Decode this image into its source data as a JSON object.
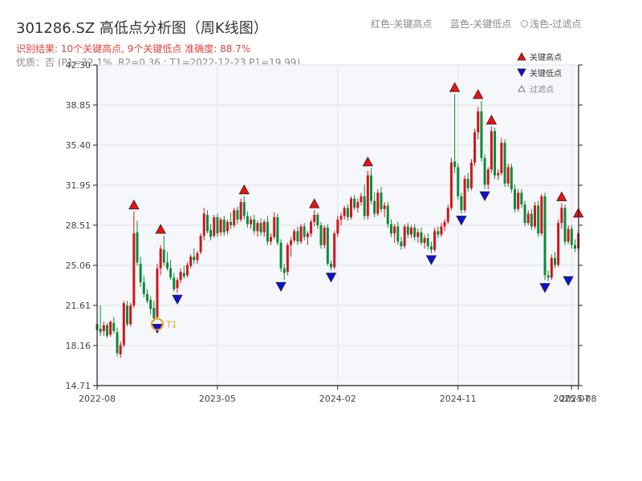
{
  "header": {
    "title": "301286.SZ 高低点分析图（周K线图）",
    "result": "识别结果: 10个关键高点, 9个关键低点   准确度: 88.7%",
    "quality": "优质：否 (P1=32.1%, R2=0.36 ; T1=2022-12-23 P1=19.99)"
  },
  "hints": {
    "red": "红色-关键高点",
    "blue": "蓝色-关键低点",
    "light": "浅色-过滤点"
  },
  "legend": {
    "high": "关键高点",
    "low": "关键低点",
    "filtered": "过滤点"
  },
  "colors": {
    "up": "#d0161c",
    "down": "#0a8c3a",
    "high_marker": "#ee1111",
    "low_marker": "#1010dd",
    "t1_marker": "#f0a020",
    "axis": "#222222",
    "grid": "#e2e2e2",
    "plot_bg": "#f5f7fa"
  },
  "chart_data": {
    "type": "candlestick",
    "x_range": [
      0,
      1
    ],
    "ylim": [
      14.71,
      42.3
    ],
    "yticks": [
      "14.71",
      "18.16",
      "21.61",
      "25.06",
      "28.51",
      "31.95",
      "35.40",
      "38.85",
      "42.30"
    ],
    "xticks": [
      {
        "x": 0.0,
        "label": "2022-08"
      },
      {
        "x": 0.2498,
        "label": "2023-05"
      },
      {
        "x": 0.4996,
        "label": "2024-02"
      },
      {
        "x": 0.7495,
        "label": "2024-11"
      },
      {
        "x": 0.9854,
        "label": "2025-07"
      },
      {
        "x": 0.9993,
        "label": "2025-08"
      }
    ],
    "candles": [
      [
        0.0,
        20.0,
        20.5,
        19.3,
        19.5
      ],
      [
        0.0069,
        19.6,
        21.6,
        19.0,
        19.3
      ],
      [
        0.0139,
        19.4,
        20.2,
        19.0,
        19.9
      ],
      [
        0.0208,
        19.9,
        20.1,
        18.8,
        19.0
      ],
      [
        0.0278,
        19.1,
        20.3,
        18.9,
        20.2
      ],
      [
        0.0347,
        20.1,
        20.6,
        19.2,
        19.4
      ],
      [
        0.0417,
        19.3,
        19.7,
        17.2,
        17.5
      ],
      [
        0.0486,
        17.4,
        18.5,
        17.1,
        18.2
      ],
      [
        0.0555,
        18.2,
        22.0,
        18.0,
        21.8
      ],
      [
        0.0625,
        21.6,
        22.0,
        19.8,
        20.0
      ],
      [
        0.0694,
        20.0,
        21.8,
        19.8,
        21.6
      ],
      [
        0.0764,
        21.6,
        29.7,
        21.4,
        27.8
      ],
      [
        0.0833,
        27.9,
        28.9,
        25.0,
        25.3
      ],
      [
        0.0902,
        25.2,
        25.8,
        23.2,
        23.6
      ],
      [
        0.0972,
        23.6,
        24.2,
        22.3,
        22.6
      ],
      [
        0.1041,
        22.6,
        23.0,
        21.8,
        22.0
      ],
      [
        0.1111,
        22.1,
        22.4,
        20.8,
        21.3
      ],
      [
        0.118,
        21.4,
        22.0,
        20.2,
        20.5
      ],
      [
        0.1249,
        20.6,
        25.2,
        20.4,
        24.8
      ],
      [
        0.1319,
        24.8,
        26.8,
        24.2,
        26.5
      ],
      [
        0.1388,
        26.4,
        27.6,
        25.0,
        25.3
      ],
      [
        0.1458,
        25.3,
        26.2,
        24.6,
        24.8
      ],
      [
        0.1527,
        24.8,
        25.5,
        23.8,
        24.0
      ],
      [
        0.1596,
        24.0,
        24.4,
        22.8,
        23.0
      ],
      [
        0.1666,
        23.1,
        24.0,
        22.7,
        23.8
      ],
      [
        0.1735,
        23.8,
        24.8,
        23.5,
        24.5
      ],
      [
        0.1805,
        24.4,
        25.0,
        23.9,
        24.1
      ],
      [
        0.1874,
        24.2,
        25.3,
        24.0,
        25.1
      ],
      [
        0.1944,
        25.0,
        26.0,
        24.8,
        25.8
      ],
      [
        0.2013,
        25.8,
        26.5,
        25.2,
        25.5
      ],
      [
        0.2082,
        25.5,
        26.3,
        25.2,
        26.1
      ],
      [
        0.2152,
        26.2,
        27.8,
        26.0,
        27.6
      ],
      [
        0.2221,
        27.6,
        30.0,
        27.2,
        29.5
      ],
      [
        0.2291,
        29.4,
        29.8,
        27.8,
        28.0
      ],
      [
        0.236,
        28.1,
        28.6,
        27.2,
        27.5
      ],
      [
        0.2429,
        27.6,
        29.4,
        27.4,
        29.2
      ],
      [
        0.2499,
        29.2,
        29.5,
        27.5,
        27.8
      ],
      [
        0.2568,
        27.9,
        29.2,
        27.6,
        29.0
      ],
      [
        0.2638,
        29.0,
        29.3,
        27.6,
        27.9
      ],
      [
        0.2707,
        28.0,
        29.0,
        27.7,
        28.8
      ],
      [
        0.2776,
        28.8,
        29.6,
        28.2,
        28.5
      ],
      [
        0.2846,
        28.5,
        30.0,
        28.3,
        29.8
      ],
      [
        0.2915,
        29.8,
        30.1,
        28.6,
        29.0
      ],
      [
        0.2985,
        29.0,
        30.8,
        28.8,
        30.5
      ],
      [
        0.3054,
        30.5,
        31.0,
        29.0,
        29.3
      ],
      [
        0.3123,
        29.3,
        29.7,
        28.3,
        28.6
      ],
      [
        0.3193,
        28.6,
        29.3,
        28.2,
        29.0
      ],
      [
        0.3262,
        29.0,
        29.4,
        27.7,
        28.0
      ],
      [
        0.3332,
        28.0,
        28.9,
        27.5,
        28.7
      ],
      [
        0.3401,
        28.7,
        29.1,
        27.6,
        27.9
      ],
      [
        0.347,
        27.9,
        29.0,
        27.5,
        28.8
      ],
      [
        0.354,
        28.8,
        29.3,
        26.8,
        27.1
      ],
      [
        0.3609,
        27.1,
        27.8,
        26.8,
        27.5
      ],
      [
        0.3679,
        27.5,
        29.6,
        27.3,
        29.2
      ],
      [
        0.3748,
        29.2,
        29.5,
        26.8,
        27.0
      ],
      [
        0.3818,
        27.0,
        27.3,
        24.5,
        24.8
      ],
      [
        0.3887,
        24.8,
        25.2,
        23.8,
        24.4
      ],
      [
        0.3956,
        24.5,
        27.0,
        24.2,
        26.8
      ],
      [
        0.4026,
        26.8,
        27.5,
        25.8,
        27.2
      ],
      [
        0.4095,
        27.2,
        28.2,
        27.0,
        28.0
      ],
      [
        0.4165,
        28.0,
        28.4,
        26.8,
        27.1
      ],
      [
        0.4234,
        27.1,
        28.6,
        26.9,
        28.4
      ],
      [
        0.4303,
        28.4,
        28.7,
        27.2,
        27.5
      ],
      [
        0.4373,
        27.5,
        28.0,
        26.8,
        27.8
      ],
      [
        0.4442,
        27.8,
        29.0,
        27.5,
        28.8
      ],
      [
        0.4512,
        28.8,
        29.8,
        28.4,
        29.4
      ],
      [
        0.4581,
        29.4,
        29.6,
        28.2,
        28.5
      ],
      [
        0.465,
        28.5,
        28.8,
        26.5,
        26.8
      ],
      [
        0.472,
        26.8,
        28.5,
        26.5,
        28.3
      ],
      [
        0.4789,
        28.3,
        28.6,
        25.0,
        25.2
      ],
      [
        0.4859,
        25.2,
        25.5,
        24.6,
        24.9
      ],
      [
        0.4928,
        24.9,
        28.0,
        24.7,
        27.8
      ],
      [
        0.4997,
        27.8,
        29.3,
        27.5,
        29.0
      ],
      [
        0.5067,
        29.0,
        29.6,
        28.5,
        29.3
      ],
      [
        0.5136,
        29.3,
        30.2,
        29.0,
        30.0
      ],
      [
        0.5206,
        30.0,
        30.3,
        28.9,
        29.2
      ],
      [
        0.5275,
        29.2,
        31.0,
        29.0,
        30.8
      ],
      [
        0.5344,
        30.8,
        31.1,
        29.8,
        30.0
      ],
      [
        0.5414,
        30.0,
        30.8,
        29.6,
        30.5
      ],
      [
        0.5483,
        30.5,
        31.3,
        30.2,
        31.0
      ],
      [
        0.5553,
        31.0,
        32.0,
        29.0,
        29.3
      ],
      [
        0.5622,
        29.3,
        33.2,
        29.0,
        32.8
      ],
      [
        0.5691,
        32.8,
        33.4,
        30.3,
        30.6
      ],
      [
        0.5761,
        30.6,
        31.3,
        29.2,
        29.5
      ],
      [
        0.583,
        29.5,
        31.6,
        29.3,
        31.3
      ],
      [
        0.59,
        31.3,
        31.8,
        29.6,
        29.9
      ],
      [
        0.5969,
        29.9,
        30.5,
        29.2,
        30.2
      ],
      [
        0.6038,
        30.2,
        30.5,
        28.3,
        28.6
      ],
      [
        0.6108,
        28.6,
        29.0,
        27.5,
        27.8
      ],
      [
        0.6177,
        27.8,
        28.6,
        27.0,
        28.4
      ],
      [
        0.6247,
        28.4,
        28.8,
        26.8,
        27.1
      ],
      [
        0.6316,
        27.1,
        27.5,
        26.4,
        26.7
      ],
      [
        0.6386,
        26.7,
        28.6,
        26.5,
        28.4
      ],
      [
        0.6455,
        28.4,
        28.7,
        27.4,
        27.7
      ],
      [
        0.6524,
        27.7,
        28.5,
        27.4,
        28.3
      ],
      [
        0.6594,
        28.3,
        28.6,
        27.2,
        27.5
      ],
      [
        0.6663,
        27.5,
        28.2,
        27.0,
        27.9
      ],
      [
        0.6733,
        27.9,
        28.3,
        26.8,
        27.0
      ],
      [
        0.6802,
        27.0,
        27.7,
        26.5,
        27.4
      ],
      [
        0.6871,
        27.4,
        27.8,
        26.4,
        26.7
      ],
      [
        0.6941,
        26.7,
        27.1,
        26.1,
        26.4
      ],
      [
        0.701,
        26.4,
        28.3,
        26.2,
        28.0
      ],
      [
        0.708,
        28.0,
        28.4,
        27.4,
        27.7
      ],
      [
        0.7149,
        27.7,
        28.7,
        27.5,
        28.4
      ],
      [
        0.7218,
        28.4,
        29.0,
        28.0,
        28.8
      ],
      [
        0.7288,
        28.8,
        30.3,
        28.6,
        30.0
      ],
      [
        0.7357,
        30.0,
        34.3,
        29.8,
        33.9
      ],
      [
        0.7427,
        34.0,
        39.8,
        33.0,
        33.5
      ],
      [
        0.7496,
        33.5,
        33.8,
        30.7,
        31.0
      ],
      [
        0.7565,
        31.0,
        31.3,
        29.5,
        29.8
      ],
      [
        0.7635,
        29.8,
        32.8,
        29.6,
        32.5
      ],
      [
        0.7704,
        32.5,
        33.0,
        31.4,
        31.7
      ],
      [
        0.7774,
        31.7,
        34.2,
        31.5,
        33.9
      ],
      [
        0.7843,
        33.9,
        36.8,
        33.6,
        36.5
      ],
      [
        0.7912,
        36.5,
        38.7,
        35.9,
        38.3
      ],
      [
        0.7982,
        38.3,
        39.2,
        34.0,
        34.3
      ],
      [
        0.8051,
        34.3,
        34.6,
        31.6,
        32.0
      ],
      [
        0.8121,
        32.0,
        33.5,
        31.6,
        33.3
      ],
      [
        0.819,
        33.3,
        37.0,
        33.0,
        36.6
      ],
      [
        0.8259,
        36.6,
        36.9,
        32.5,
        32.8
      ],
      [
        0.8329,
        32.8,
        33.3,
        32.4,
        33.0
      ],
      [
        0.8398,
        33.0,
        36.0,
        32.8,
        35.6
      ],
      [
        0.8468,
        35.6,
        35.9,
        31.8,
        32.1
      ],
      [
        0.8537,
        32.1,
        33.8,
        31.8,
        33.5
      ],
      [
        0.8606,
        33.5,
        33.8,
        31.3,
        31.6
      ],
      [
        0.8676,
        31.6,
        32.0,
        29.6,
        29.9
      ],
      [
        0.8745,
        29.9,
        31.6,
        29.7,
        31.3
      ],
      [
        0.8815,
        31.3,
        31.6,
        30.0,
        30.3
      ],
      [
        0.8884,
        30.3,
        30.6,
        28.4,
        28.7
      ],
      [
        0.8954,
        28.7,
        29.8,
        28.5,
        29.5
      ],
      [
        0.9023,
        29.5,
        29.9,
        28.1,
        28.4
      ],
      [
        0.9092,
        28.4,
        30.5,
        28.2,
        30.2
      ],
      [
        0.9162,
        30.2,
        30.6,
        27.5,
        27.8
      ],
      [
        0.9231,
        27.8,
        31.2,
        27.6,
        31.0
      ],
      [
        0.9301,
        31.0,
        31.3,
        23.8,
        24.2
      ],
      [
        0.937,
        24.2,
        24.6,
        23.7,
        24.0
      ],
      [
        0.9439,
        24.0,
        26.0,
        23.8,
        25.7
      ],
      [
        0.9509,
        25.7,
        26.2,
        24.8,
        25.1
      ],
      [
        0.9578,
        25.1,
        29.0,
        24.9,
        28.7
      ],
      [
        0.9648,
        28.7,
        30.4,
        28.2,
        30.0
      ],
      [
        0.9717,
        30.0,
        30.3,
        26.8,
        27.1
      ],
      [
        0.9786,
        27.1,
        28.5,
        26.9,
        28.2
      ],
      [
        0.9856,
        28.2,
        28.5,
        26.5,
        26.8
      ],
      [
        0.9925,
        26.8,
        27.3,
        26.2,
        26.5
      ],
      [
        0.9995,
        26.5,
        28.0,
        26.2,
        27.8
      ]
    ],
    "key_highs": [
      [
        0.0764,
        29.7
      ],
      [
        0.1319,
        27.6
      ],
      [
        0.3054,
        31.0
      ],
      [
        0.4512,
        29.8
      ],
      [
        0.5622,
        33.4
      ],
      [
        0.7427,
        39.8
      ],
      [
        0.7912,
        39.2
      ],
      [
        0.819,
        37.0
      ],
      [
        0.9648,
        30.4
      ],
      [
        0.9995,
        29.0
      ]
    ],
    "key_lows": [
      [
        0.1249,
        20.2
      ],
      [
        0.1666,
        22.7
      ],
      [
        0.3818,
        23.8
      ],
      [
        0.4859,
        24.6
      ],
      [
        0.6941,
        26.1
      ],
      [
        0.7565,
        29.5
      ],
      [
        0.8051,
        31.6
      ],
      [
        0.9301,
        23.7
      ],
      [
        0.9786,
        24.3
      ]
    ],
    "t1_point": {
      "x": 0.1249,
      "y": 19.99,
      "label": "T1"
    }
  }
}
